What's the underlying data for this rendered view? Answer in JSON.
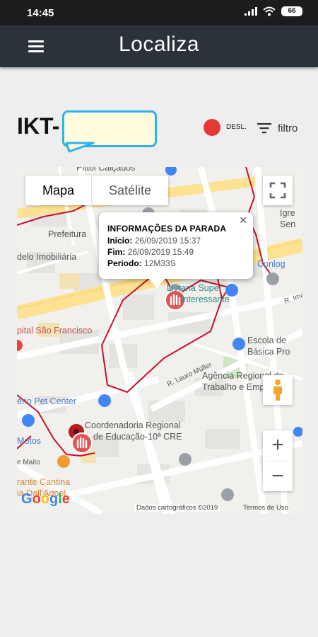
{
  "status_bar": {
    "time": "14:45",
    "battery": "66"
  },
  "app_bar": {
    "title": "Localiza"
  },
  "device": {
    "label": "IKT-",
    "status": "DESL.",
    "filter_label": "filtro"
  },
  "map": {
    "type_buttons": {
      "map": "Mapa",
      "satellite": "Satélite"
    },
    "zoom_in": "+",
    "zoom_out": "−",
    "credits": "Dados cartográficos ©2019",
    "terms": "Termos de Uso",
    "pois": {
      "pittol": "Pittol Calçados",
      "prefeitura": "Prefeitura",
      "imobiliaria": "delo Imobiliária",
      "igreja": "Igre",
      "igreja2": "Sen",
      "conlog": "Conlog",
      "livraria": "Livraria Super",
      "livraria2": "Interessante",
      "r_ima": "R. Ima",
      "hospital": "pital São Francisco",
      "escola": "Escola de",
      "escola2": "Básica Pro",
      "agencia": "Agência Regional do",
      "agencia2": "Trabalho e Empre",
      "rua_lauro": "R. Lauro Müller",
      "pet": "ério Pet Center",
      "coord": "Coordenadoria Regional",
      "coord2": "de Educação-10ª CRE",
      "motos": "Motos",
      "maito": "e Maito",
      "cantina": "rante Cantina",
      "cantina2": "ia Dall'Agnol"
    },
    "info_window": {
      "title": "INFORMAÇÕES DA PARADA",
      "start_label": "Inicio:",
      "start_value": "26/09/2019 15:37",
      "end_label": "Fim:",
      "end_value": "26/09/2019 15:49",
      "period_label": "Periodo:",
      "period_value": "12M33S"
    }
  },
  "colors": {
    "app_bar": "#2b323a",
    "route": "#c8102e",
    "status_off": "#e53935",
    "highlight_border": "#2bb3f0"
  }
}
